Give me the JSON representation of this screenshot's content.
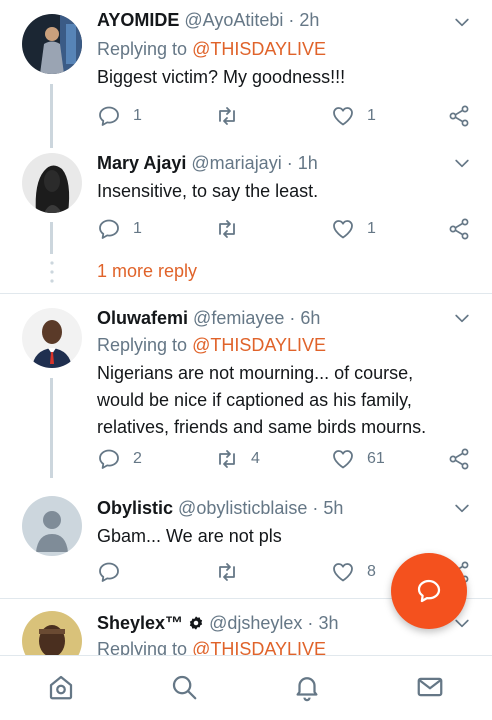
{
  "tweets": [
    {
      "name": "AYOMIDE",
      "handle": "@AyoAtitebi",
      "dot": "·",
      "time": "2h",
      "replying_prefix": "Replying to",
      "replying_mention": "@THISDAYLIVE",
      "text": "Biggest victim? My goodness!!!",
      "replies": "1",
      "retweets": "",
      "likes": "1"
    },
    {
      "name": "Mary Ajayi",
      "handle": "@mariajayi",
      "dot": "·",
      "time": "1h",
      "text": "Insensitive, to say the least.",
      "replies": "1",
      "retweets": "",
      "likes": "1"
    },
    {
      "name": "Oluwafemi",
      "handle": "@femiayee",
      "dot": "·",
      "time": "6h",
      "replying_prefix": "Replying to",
      "replying_mention": "@THISDAYLIVE",
      "text_lines": [
        "Nigerians are not mourning... of course,",
        "would be nice if captioned as his family,",
        "relatives, friends and same birds mourns."
      ],
      "replies": "2",
      "retweets": "4",
      "likes": "61"
    },
    {
      "name": "Obylistic",
      "handle": "@obylisticblaise",
      "dot": "·",
      "time": "5h",
      "text": "Gbam... We are not pls",
      "replies": "",
      "retweets": "",
      "likes": "8"
    },
    {
      "name": "Sheylex™",
      "handle": "@djsheylex",
      "dot": "·",
      "time": "3h",
      "replying_prefix": "Replying to",
      "replying_mention": "@THISDAYLIVE"
    }
  ],
  "more_reply_label": "1 more reply",
  "colors": {
    "accent": "#e0632a",
    "fab": "#f4511e",
    "muted": "#657786",
    "divider": "#e1e8ed"
  },
  "icons": {
    "reply": "reply-icon",
    "retweet": "retweet-icon",
    "like": "heart-icon",
    "share": "share-icon",
    "caret": "chevron-down-icon",
    "verified": "verified-badge-icon",
    "compose": "compose-reply-icon",
    "nav": [
      "home-icon",
      "search-icon",
      "notifications-icon",
      "messages-icon"
    ]
  }
}
